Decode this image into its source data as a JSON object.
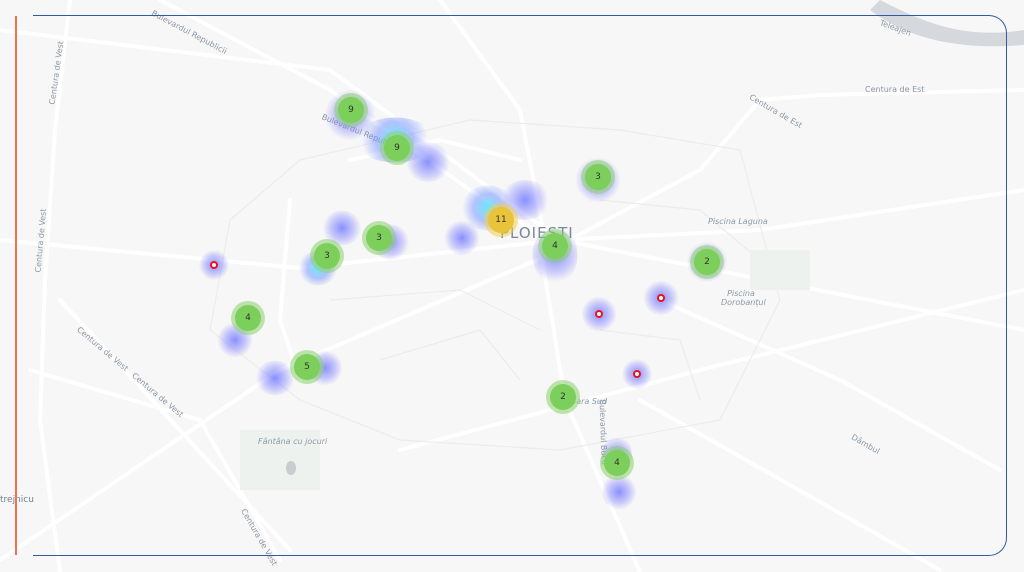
{
  "map": {
    "city_label": "PLOIEȘTI",
    "street_labels": [
      "Bulevardul Republicii",
      "Bulevardul Republicii",
      "Centura de Vest",
      "Centura de Vest",
      "Centura de Vest",
      "Centura de Vest",
      "Centura de Vest",
      "Centura de Est",
      "Centura de Est",
      "Teleajen",
      "Dâmbul",
      "Bulevardul Bucu",
      "trejnicu"
    ],
    "poi_labels": [
      "Piscina Laguna",
      "Piscina Dorobanțul",
      "Fântâna cu jocuri",
      "Gara Sud"
    ],
    "clusters": [
      {
        "count": "9",
        "color": "green"
      },
      {
        "count": "9",
        "color": "green"
      },
      {
        "count": "11",
        "color": "yellow"
      },
      {
        "count": "3",
        "color": "green"
      },
      {
        "count": "4",
        "color": "green"
      },
      {
        "count": "3",
        "color": "green"
      },
      {
        "count": "3",
        "color": "green"
      },
      {
        "count": "2",
        "color": "green"
      },
      {
        "count": "4",
        "color": "green"
      },
      {
        "count": "5",
        "color": "green"
      },
      {
        "count": "2",
        "color": "green"
      },
      {
        "count": "4",
        "color": "green"
      }
    ],
    "single_marker_color": "#f0101c",
    "cluster_colors": {
      "green": "#7ccf5a",
      "yellow": "#e9c33a"
    },
    "heatmap_color": "#6e6eff"
  },
  "frame": {
    "left_accent": "#f07050",
    "border": "#3559a0"
  }
}
